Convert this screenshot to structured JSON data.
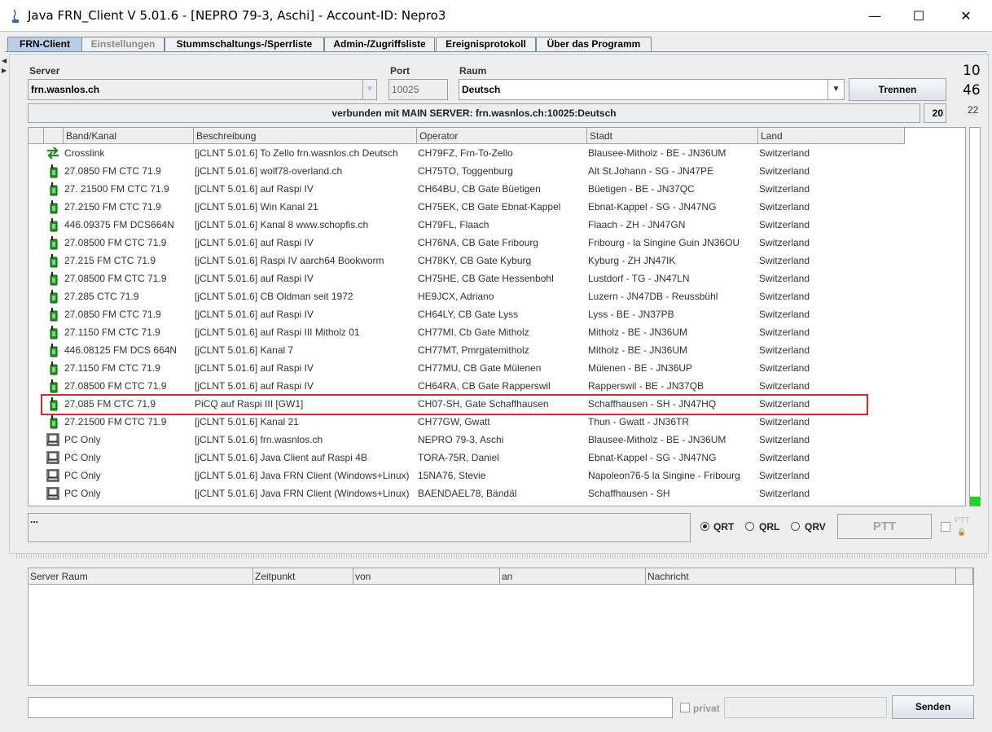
{
  "window": {
    "title": "Java FRN_Client V 5.01.6 - [NEPRO 79-3, Aschi] - Account-ID: Nepro3",
    "minimize": "—",
    "maximize": "☐",
    "close": "✕"
  },
  "tabs": [
    {
      "label": "FRN-Client",
      "state": "active"
    },
    {
      "label": "Einstellungen",
      "state": "disabled"
    },
    {
      "label": "Stummschaltungs-/Sperrliste",
      "state": "normal"
    },
    {
      "label": "Admin-/Zugriffsliste",
      "state": "normal"
    },
    {
      "label": "Ereignisprotokoll",
      "state": "normal"
    },
    {
      "label": "Über das Programm",
      "state": "normal"
    }
  ],
  "connection": {
    "server_label": "Server",
    "server_value": "frn.wasnlos.ch",
    "port_label": "Port",
    "port_value": "10025",
    "room_label": "Raum",
    "room_value": "Deutsch",
    "disconnect_button": "Trennen",
    "status": "verbunden mit  MAIN SERVER: frn.wasnlos.ch:10025:Deutsch",
    "count_top": "10",
    "count_mid": "46",
    "count_small": "22",
    "count_box": "20"
  },
  "client_table": {
    "columns": [
      "Band/Kanal",
      "Beschreibung",
      "Operator",
      "Stadt",
      "Land"
    ],
    "rows": [
      {
        "icon": "crosslink-icon",
        "band": "Crosslink",
        "desc": "[jCLNT 5.01.6] To Zello frn.wasnlos.ch Deutsch",
        "op": "CH79FZ, Frn-To-Zello",
        "city": "Blausee-Mitholz - BE - JN36UM",
        "country": "Switzerland"
      },
      {
        "icon": "radio-icon",
        "band": "27.0850 FM CTC 71.9",
        "desc": "[jCLNT 5.01.6] wolf78-overland.ch",
        "op": "CH75TO, Toggenburg",
        "city": "Alt St.Johann - SG - JN47PE",
        "country": "Switzerland"
      },
      {
        "icon": "radio-icon",
        "band": "27. 21500 FM CTC 71.9",
        "desc": "[jCLNT 5.01.6] auf Raspi IV",
        "op": "CH64BU, CB Gate Büetigen",
        "city": "Büetigen - BE - JN37QC",
        "country": "Switzerland"
      },
      {
        "icon": "radio-icon",
        "band": "27.2150 FM CTC 71.9",
        "desc": "[jCLNT 5.01.6] Win Kanal 21",
        "op": "CH75EK, CB Gate Ebnat-Kappel",
        "city": "Ebnat-Kappel - SG - JN47NG",
        "country": "Switzerland"
      },
      {
        "icon": "radio-icon",
        "band": "446.09375 FM DCS664N",
        "desc": "[jCLNT 5.01.6] Kanal 8  www.schopfis.ch",
        "op": "CH79FL, Flaach",
        "city": "Flaach - ZH - JN47GN",
        "country": "Switzerland"
      },
      {
        "icon": "radio-icon",
        "band": "27.08500 FM CTC 71.9",
        "desc": "[jCLNT 5.01.6] auf Raspi IV",
        "op": "CH76NA, CB Gate Fribourg",
        "city": "Fribourg - la Singine Guin JN36OU",
        "country": "Switzerland"
      },
      {
        "icon": "radio-icon",
        "band": "27.215 FM CTC 71.9",
        "desc": "[jCLNT 5.01.6] Raspi IV aarch64 Bookworm",
        "op": "CH78KY, CB Gate Kyburg",
        "city": "Kyburg - ZH JN47IK",
        "country": "Switzerland"
      },
      {
        "icon": "radio-icon",
        "band": "27.08500 FM CTC 71.9",
        "desc": "[jCLNT 5.01.6] auf Raspi IV",
        "op": "CH75HE, CB Gate Hessenbohl",
        "city": "Lustdorf - TG - JN47LN",
        "country": "Switzerland"
      },
      {
        "icon": "radio-icon",
        "band": "27.285 CTC 71.9",
        "desc": "[jCLNT 5.01.6] CB Oldman seit 1972",
        "op": "HE9JCX, Adriano",
        "city": "Luzern - JN47DB - Reussbühl",
        "country": "Switzerland"
      },
      {
        "icon": "radio-icon",
        "band": "27.0850 FM CTC 71.9",
        "desc": "[jCLNT 5.01.6] auf Raspi IV",
        "op": "CH64LY, CB Gate Lyss",
        "city": "Lyss - BE - JN37PB",
        "country": "Switzerland"
      },
      {
        "icon": "radio-icon",
        "band": "27.1150 FM CTC 71.9",
        "desc": "[jCLNT 5.01.6] auf Raspi III  Mitholz 01",
        "op": "CH77MI, Cb Gate Mitholz",
        "city": "Mitholz - BE - JN36UM",
        "country": "Switzerland"
      },
      {
        "icon": "radio-icon",
        "band": "446.08125 FM DCS 664N",
        "desc": "[jCLNT 5.01.6] Kanal 7",
        "op": "CH77MT, Pmrgatemitholz",
        "city": "Mitholz - BE - JN36UM",
        "country": "Switzerland"
      },
      {
        "icon": "radio-icon",
        "band": "27.1150 FM CTC 71.9",
        "desc": "[jCLNT 5.01.6] auf Raspi IV",
        "op": "CH77MU, CB Gate Mülenen",
        "city": "Mülenen - BE - JN36UP",
        "country": "Switzerland"
      },
      {
        "icon": "radio-icon",
        "band": "27.08500 FM CTC 71.9",
        "desc": "[jCLNT 5.01.6] auf Raspi IV",
        "op": "CH64RA, CB Gate Rapperswil",
        "city": "Rapperswil - BE - JN37QB",
        "country": "Switzerland"
      },
      {
        "icon": "radio-icon",
        "band": "27,085 FM CTC 71,9",
        "desc": "PiCQ auf Raspi III [GW1]",
        "op": "CH07-SH, Gate Schaffhausen",
        "city": "Schaffhausen - SH - JN47HQ",
        "country": "Switzerland"
      },
      {
        "icon": "radio-icon",
        "band": "27.21500 FM CTC 71.9",
        "desc": "[jCLNT 5.01.6] Kanal 21",
        "op": "CH77GW, Gwatt",
        "city": "Thun - Gwatt - JN36TR",
        "country": "Switzerland"
      },
      {
        "icon": "pc-icon",
        "band": "PC Only",
        "desc": "[jCLNT 5.01.6] frn.wasnlos.ch",
        "op": "NEPRO 79-3, Aschi",
        "city": "Blausee-Mitholz - BE - JN36UM",
        "country": "Switzerland"
      },
      {
        "icon": "pc-icon",
        "band": "PC Only",
        "desc": "[jCLNT 5.01.6] Java Client auf Raspi 4B",
        "op": "TORA-75R, Daniel",
        "city": "Ebnat-Kappel - SG - JN47NG",
        "country": "Switzerland"
      },
      {
        "icon": "pc-icon",
        "band": "PC Only",
        "desc": "[jCLNT 5.01.6] Java FRN Client (Windows+Linux)",
        "op": "15NA76, Stevie",
        "city": "Napoleon76-5 la Singine - Fribourg",
        "country": "Switzerland"
      },
      {
        "icon": "pc-icon",
        "band": "PC Only",
        "desc": "[jCLNT 5.01.6] Java FRN Client (Windows+Linux)",
        "op": "BAENDAEL78, Bändäl",
        "city": "Schaffhausen - SH",
        "country": "Switzerland"
      }
    ]
  },
  "transmit": {
    "info_text": "...",
    "radio_options": [
      {
        "label": "QRT",
        "selected": true
      },
      {
        "label": "QRL",
        "selected": false
      },
      {
        "label": "QRV",
        "selected": false
      }
    ],
    "ptt_button": "PTT",
    "ptt_lock_label": "PTT"
  },
  "messages": {
    "columns": [
      "Server Raum",
      "Zeitpunkt",
      "von",
      "an",
      "Nachricht"
    ],
    "input_value": "",
    "private_label": "privat",
    "send_button": "Senden"
  },
  "colors": {
    "highlight_border": "#e0262c",
    "active_tab": "#b8cfe5",
    "level_meter": "#1ed51e"
  }
}
